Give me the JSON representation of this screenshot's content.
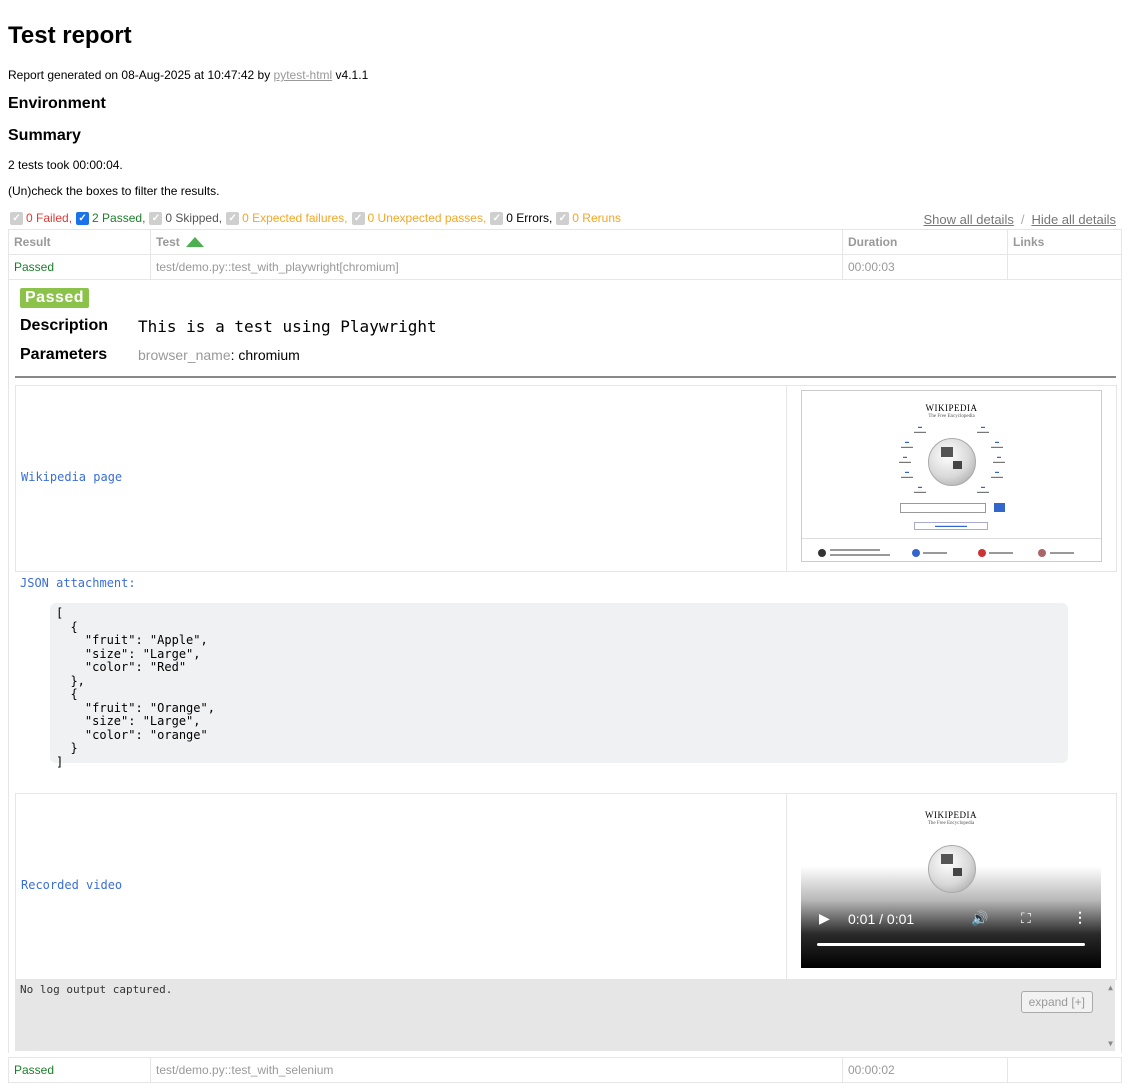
{
  "title": "Test report",
  "generated": {
    "prefix": "Report generated on 08-Aug-2025 at 10:47:42 by ",
    "link": "pytest-html",
    "suffix": " v4.1.1"
  },
  "environment_heading": "Environment",
  "summary_heading": "Summary",
  "summary_text": "2 tests took 00:00:04.",
  "filter_hint": "(Un)check the boxes to filter the results.",
  "filters": [
    {
      "label": "0 Failed,",
      "checked": false,
      "color": "#e53935"
    },
    {
      "label": "2 Passed,",
      "checked": true,
      "color": "#1a7f2a"
    },
    {
      "label": "0 Skipped,",
      "checked": false,
      "color": "#555555"
    },
    {
      "label": "0 Expected failures,",
      "checked": false,
      "color": "#f5a623"
    },
    {
      "label": "0 Unexpected passes,",
      "checked": false,
      "color": "#f5a623"
    },
    {
      "label": "0 Errors,",
      "checked": false,
      "color": "#000000"
    },
    {
      "label": "0 Reruns",
      "checked": false,
      "color": "#f5a623"
    }
  ],
  "show_all": "Show all details",
  "separator": "/",
  "hide_all": "Hide all details",
  "columns": {
    "result": "Result",
    "test": "Test",
    "duration": "Duration",
    "links": "Links"
  },
  "rows": [
    {
      "result": "Passed",
      "test": "test/demo.py::test_with_playwright[chromium]",
      "duration": "00:00:03",
      "links": ""
    },
    {
      "result": "Passed",
      "test": "test/demo.py::test_with_selenium",
      "duration": "00:00:02",
      "links": ""
    }
  ],
  "extra": {
    "badge": "Passed",
    "description_label": "Description",
    "description_value": "This is a test using Playwright",
    "parameters_label": "Parameters",
    "param_key": "browser_name",
    "param_value": ": chromium",
    "wikipedia_label": "Wikipedia page",
    "json_label": "JSON attachment:",
    "json_text": "[\n  {\n    \"fruit\": \"Apple\",\n    \"size\": \"Large\",\n    \"color\": \"Red\"\n  },\n  {\n    \"fruit\": \"Orange\",\n    \"size\": \"Large\",\n    \"color\": \"orange\"\n  }\n]",
    "video_label": "Recorded video",
    "video_time": "0:01 / 0:01",
    "log_text": "No log output captured.",
    "expand_label": "expand [+]"
  },
  "thumbnail": {
    "wiki_title": "WIKIPEDIA",
    "wiki_sub": "The Free Encyclopedia"
  }
}
